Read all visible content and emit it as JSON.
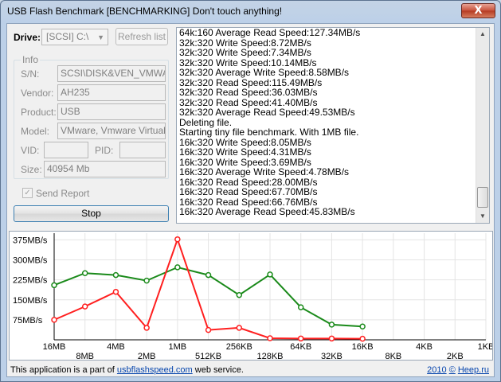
{
  "window": {
    "title": "USB Flash Benchmark [BENCHMARKING] Don't touch anything!",
    "close_glyph": "X"
  },
  "drive": {
    "label": "Drive:",
    "selected": "[SCSI] C:\\",
    "arrow_glyph": "▼",
    "refresh_label": "Refresh list"
  },
  "info": {
    "group_title": "Info",
    "sn_label": "S/N:",
    "sn_value": "SCSI\\DISK&VEN_VMWARE_&",
    "vendor_label": "Vendor:",
    "vendor_value": "AH235",
    "product_label": "Product:",
    "product_value": "USB",
    "model_label": "Model:",
    "model_value": "VMware, Vmware Virtual S S",
    "vid_label": "VID:",
    "vid_value": "",
    "pid_label": "PID:",
    "pid_value": "",
    "size_label": "Size:",
    "size_value": "40954 Mb"
  },
  "send_report": {
    "label": "Send Report",
    "checked": true,
    "check_glyph": "✓"
  },
  "stop_label": "Stop",
  "log_lines": [
    "64k:160 Average Read Speed:127.34MB/s",
    "32k:320 Write Speed:8.72MB/s",
    "32k:320 Write Speed:7.34MB/s",
    "32k:320 Write Speed:10.14MB/s",
    "32k:320 Average Write Speed:8.58MB/s",
    "32k:320 Read Speed:115.49MB/s",
    "32k:320 Read Speed:36.03MB/s",
    "32k:320 Read Speed:41.40MB/s",
    "32k:320 Average Read Speed:49.53MB/s",
    "Deleting file.",
    "Starting tiny file benchmark. With 1MB file.",
    "16k:320 Write Speed:8.05MB/s",
    "16k:320 Write Speed:4.31MB/s",
    "16k:320 Write Speed:3.69MB/s",
    "16k:320 Average Write Speed:4.78MB/s",
    "16k:320 Read Speed:28.00MB/s",
    "16k:320 Read Speed:67.70MB/s",
    "16k:320 Read Speed:66.76MB/s",
    "16k:320 Average Read Speed:45.83MB/s"
  ],
  "scrollbar": {
    "up_glyph": "▲",
    "down_glyph": "▼"
  },
  "chart_data": {
    "type": "line",
    "y_ticks": [
      "375MB/s",
      "300MB/s",
      "225MB/s",
      "150MB/s",
      "75MB/s"
    ],
    "y_tick_values": [
      375,
      300,
      225,
      150,
      75
    ],
    "ylim": [
      0,
      400
    ],
    "categories": [
      "16MB",
      "8MB",
      "4MB",
      "2MB",
      "1MB",
      "512KB",
      "256KB",
      "128KB",
      "64KB",
      "32KB",
      "16KB",
      "8KB",
      "4KB",
      "2KB",
      "1KB"
    ],
    "series": [
      {
        "color": "#1a8a1a",
        "values": [
          205,
          250,
          243,
          222,
          272,
          243,
          168,
          245,
          122,
          57,
          50
        ]
      },
      {
        "color": "#ff1f1f",
        "values": [
          75,
          125,
          180,
          45,
          377,
          37,
          45,
          6,
          5,
          5,
          4
        ]
      }
    ],
    "grid": true,
    "legend": "none"
  },
  "status": {
    "text_before": "This application is a part of",
    "link": "usbflashspeed.com",
    "text_after": "web service.",
    "year": "2010",
    "copy": "©",
    "author": "Heep.ru"
  }
}
